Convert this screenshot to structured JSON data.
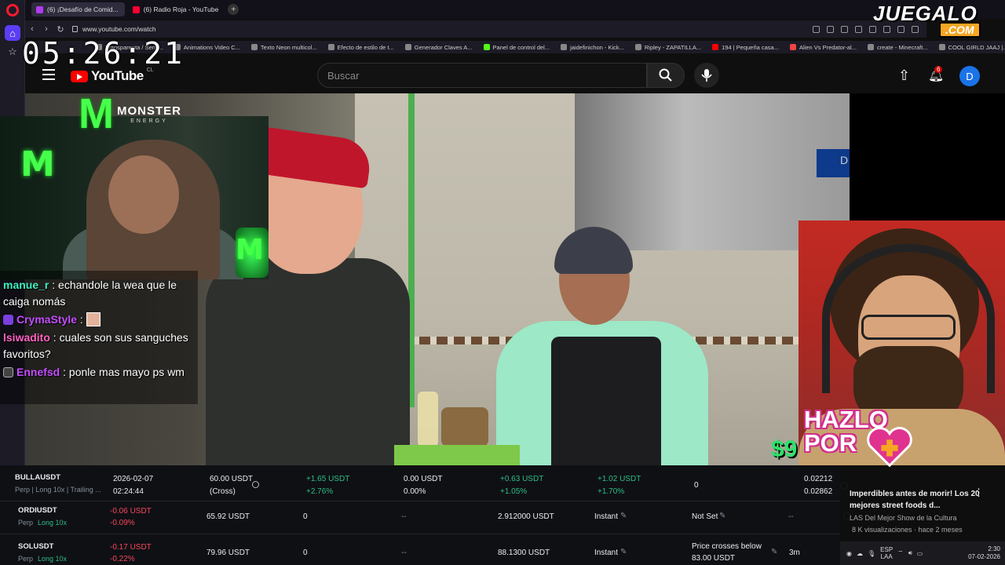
{
  "browser": {
    "tabs": [
      {
        "label": "(6) ¡Desafío de Comid...",
        "active": true
      },
      {
        "label": "(6) Radio Roja - YouTube",
        "active": false
      }
    ],
    "url": "www.youtube.com/watch",
    "bookmarks": [
      "Transparenta / Semi...",
      "Animations Video C...",
      "Texto Neon multicol...",
      "Efecto de estilo de t...",
      "Generador Claves A...",
      "Panel de control del...",
      "jaidefinichon - Kick...",
      "Ripley - ZAPATILLA...",
      "194 | Pequeña casa...",
      "Alien Vs Predator-al...",
      "create - Minecraft...",
      "COOL GIRLD JAAJ |..."
    ]
  },
  "overlay": {
    "clock": "05:26:21",
    "brand_top": "JUEGALO",
    "brand_bottom": ".COM",
    "monster_text": "MONSTER",
    "monster_sub": "ENERGY",
    "hazlo_line1": "HAZLO",
    "hazlo_line2": "POR",
    "price": "$9"
  },
  "youtube": {
    "logo": "YouTube",
    "country": "CL",
    "search_placeholder": "Buscar",
    "notif_count": "6",
    "avatar_letter": "D"
  },
  "chat": [
    {
      "user": "manue_r",
      "text": "echandole la wea que le caiga nomás",
      "color": "#3df0c2",
      "badge": ""
    },
    {
      "user": "CrymaStyle",
      "text": "",
      "color": "#c44dff",
      "badge": "b1",
      "emote": true
    },
    {
      "user": "lsiwadito",
      "text": "cuales son sus sanguches favoritos?",
      "color": "#ff62c0",
      "badge": ""
    },
    {
      "user": "Ennefsd",
      "text": "ponle mas mayo ps wm",
      "color": "#c44dff",
      "badge": "b2"
    }
  ],
  "trades": [
    {
      "symbol": "BULLAUSDT",
      "meta": "Perp | Long 10x | Trailing ...",
      "date": "2026-02-07",
      "time": "02:24:44",
      "margin": "60.00 USDT",
      "margin_mode": "(Cross)",
      "pnl1": "+1.65 USDT",
      "pnl1_pct": "+2.76%",
      "pnl2": "0.00 USDT",
      "pnl2_pct": "0.00%",
      "pnl3": "+0.63 USDT",
      "pnl3_pct": "+1.05%",
      "pnl4": "+1.02 USDT",
      "pnl4_pct": "+1.70%",
      "qty": "0",
      "price_a": "0.02212",
      "price_b": "0.02862"
    },
    {
      "symbol": "ORDIUSDT",
      "meta_a": "Perp",
      "meta_b": "Long 10x",
      "pnl": "-0.06 USDT",
      "pnl_pct": "-0.09%",
      "value": "65.92 USDT",
      "qty": "0",
      "dash1": "--",
      "price": "2.912000 USDT",
      "mode": "Instant",
      "tp": "Not Set",
      "dash2": "--"
    },
    {
      "symbol": "SOLUSDT",
      "meta_a": "Perp",
      "meta_b": "Long 10x",
      "pnl": "-0.17 USDT",
      "pnl_pct": "-0.22%",
      "value": "79.96 USDT",
      "qty": "0",
      "dash1": "--",
      "price": "88.1300 USDT",
      "mode": "Instant",
      "tp_line1": "Price crosses below",
      "tp_line2": "83.00 USDT",
      "interval": "3m"
    }
  ],
  "recommendation": {
    "title": "Imperdibles antes de morir! Los 20 mejores street foods d...",
    "channel": "LAS Del Mejor Show de la Cultura",
    "views": "8 K visualizaciones · hace 2 meses"
  },
  "tray": {
    "lang1": "ESP",
    "lang2": "LAA",
    "time": "2:30",
    "date": "07-02-2026"
  }
}
